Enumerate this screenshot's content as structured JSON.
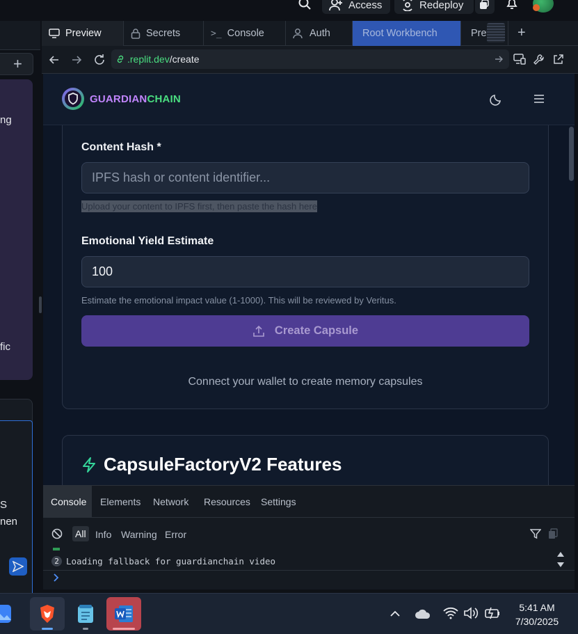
{
  "topbar": {
    "access_label": "Access",
    "redeploy_label": "Redeploy"
  },
  "left_panel": {
    "snippet_1": "ng",
    "snippet_2": "fic",
    "snippet_3": "S",
    "snippet_4": "nen"
  },
  "tabs": [
    {
      "label": "Preview",
      "icon": "monitor-icon"
    },
    {
      "label": "Secrets",
      "icon": "lock-icon"
    },
    {
      "label": "Console",
      "icon": "terminal-icon"
    },
    {
      "label": "Auth",
      "icon": "user-icon"
    },
    {
      "label": "Root Workbench",
      "icon": ""
    },
    {
      "label": "Prettier",
      "icon": ""
    }
  ],
  "urlbar": {
    "domain": ".replit.dev",
    "path": "/create"
  },
  "app": {
    "brand_part1": "GUARDIAN",
    "brand_part2": "CHAIN",
    "content_hash_label": "Content Hash *",
    "content_hash_placeholder": "IPFS hash or content identifier...",
    "content_hash_hint": "Upload your content to IPFS first, then paste the hash here",
    "yield_label": "Emotional Yield Estimate",
    "yield_value": "100",
    "yield_hint": "Estimate the emotional impact value (1-1000). This will be reviewed by Veritus.",
    "create_button": "Create Capsule",
    "connect_notice": "Connect your wallet to create memory capsules",
    "features_title": "CapsuleFactoryV2 Features"
  },
  "devtools": {
    "tabs": [
      "Console",
      "Elements",
      "Network",
      "Resources",
      "Settings"
    ],
    "filters": [
      "All",
      "Info",
      "Warning",
      "Error"
    ],
    "log_count": "2",
    "log_message": "Loading fallback for guardianchain video"
  },
  "taskbar": {
    "time": "5:41 AM",
    "date": "7/30/2025"
  },
  "colors": {
    "brand_purple": "#c084fc",
    "brand_green": "#4ade80",
    "button_bg": "#4e3c93",
    "accent_tab": "#2f57b3"
  }
}
